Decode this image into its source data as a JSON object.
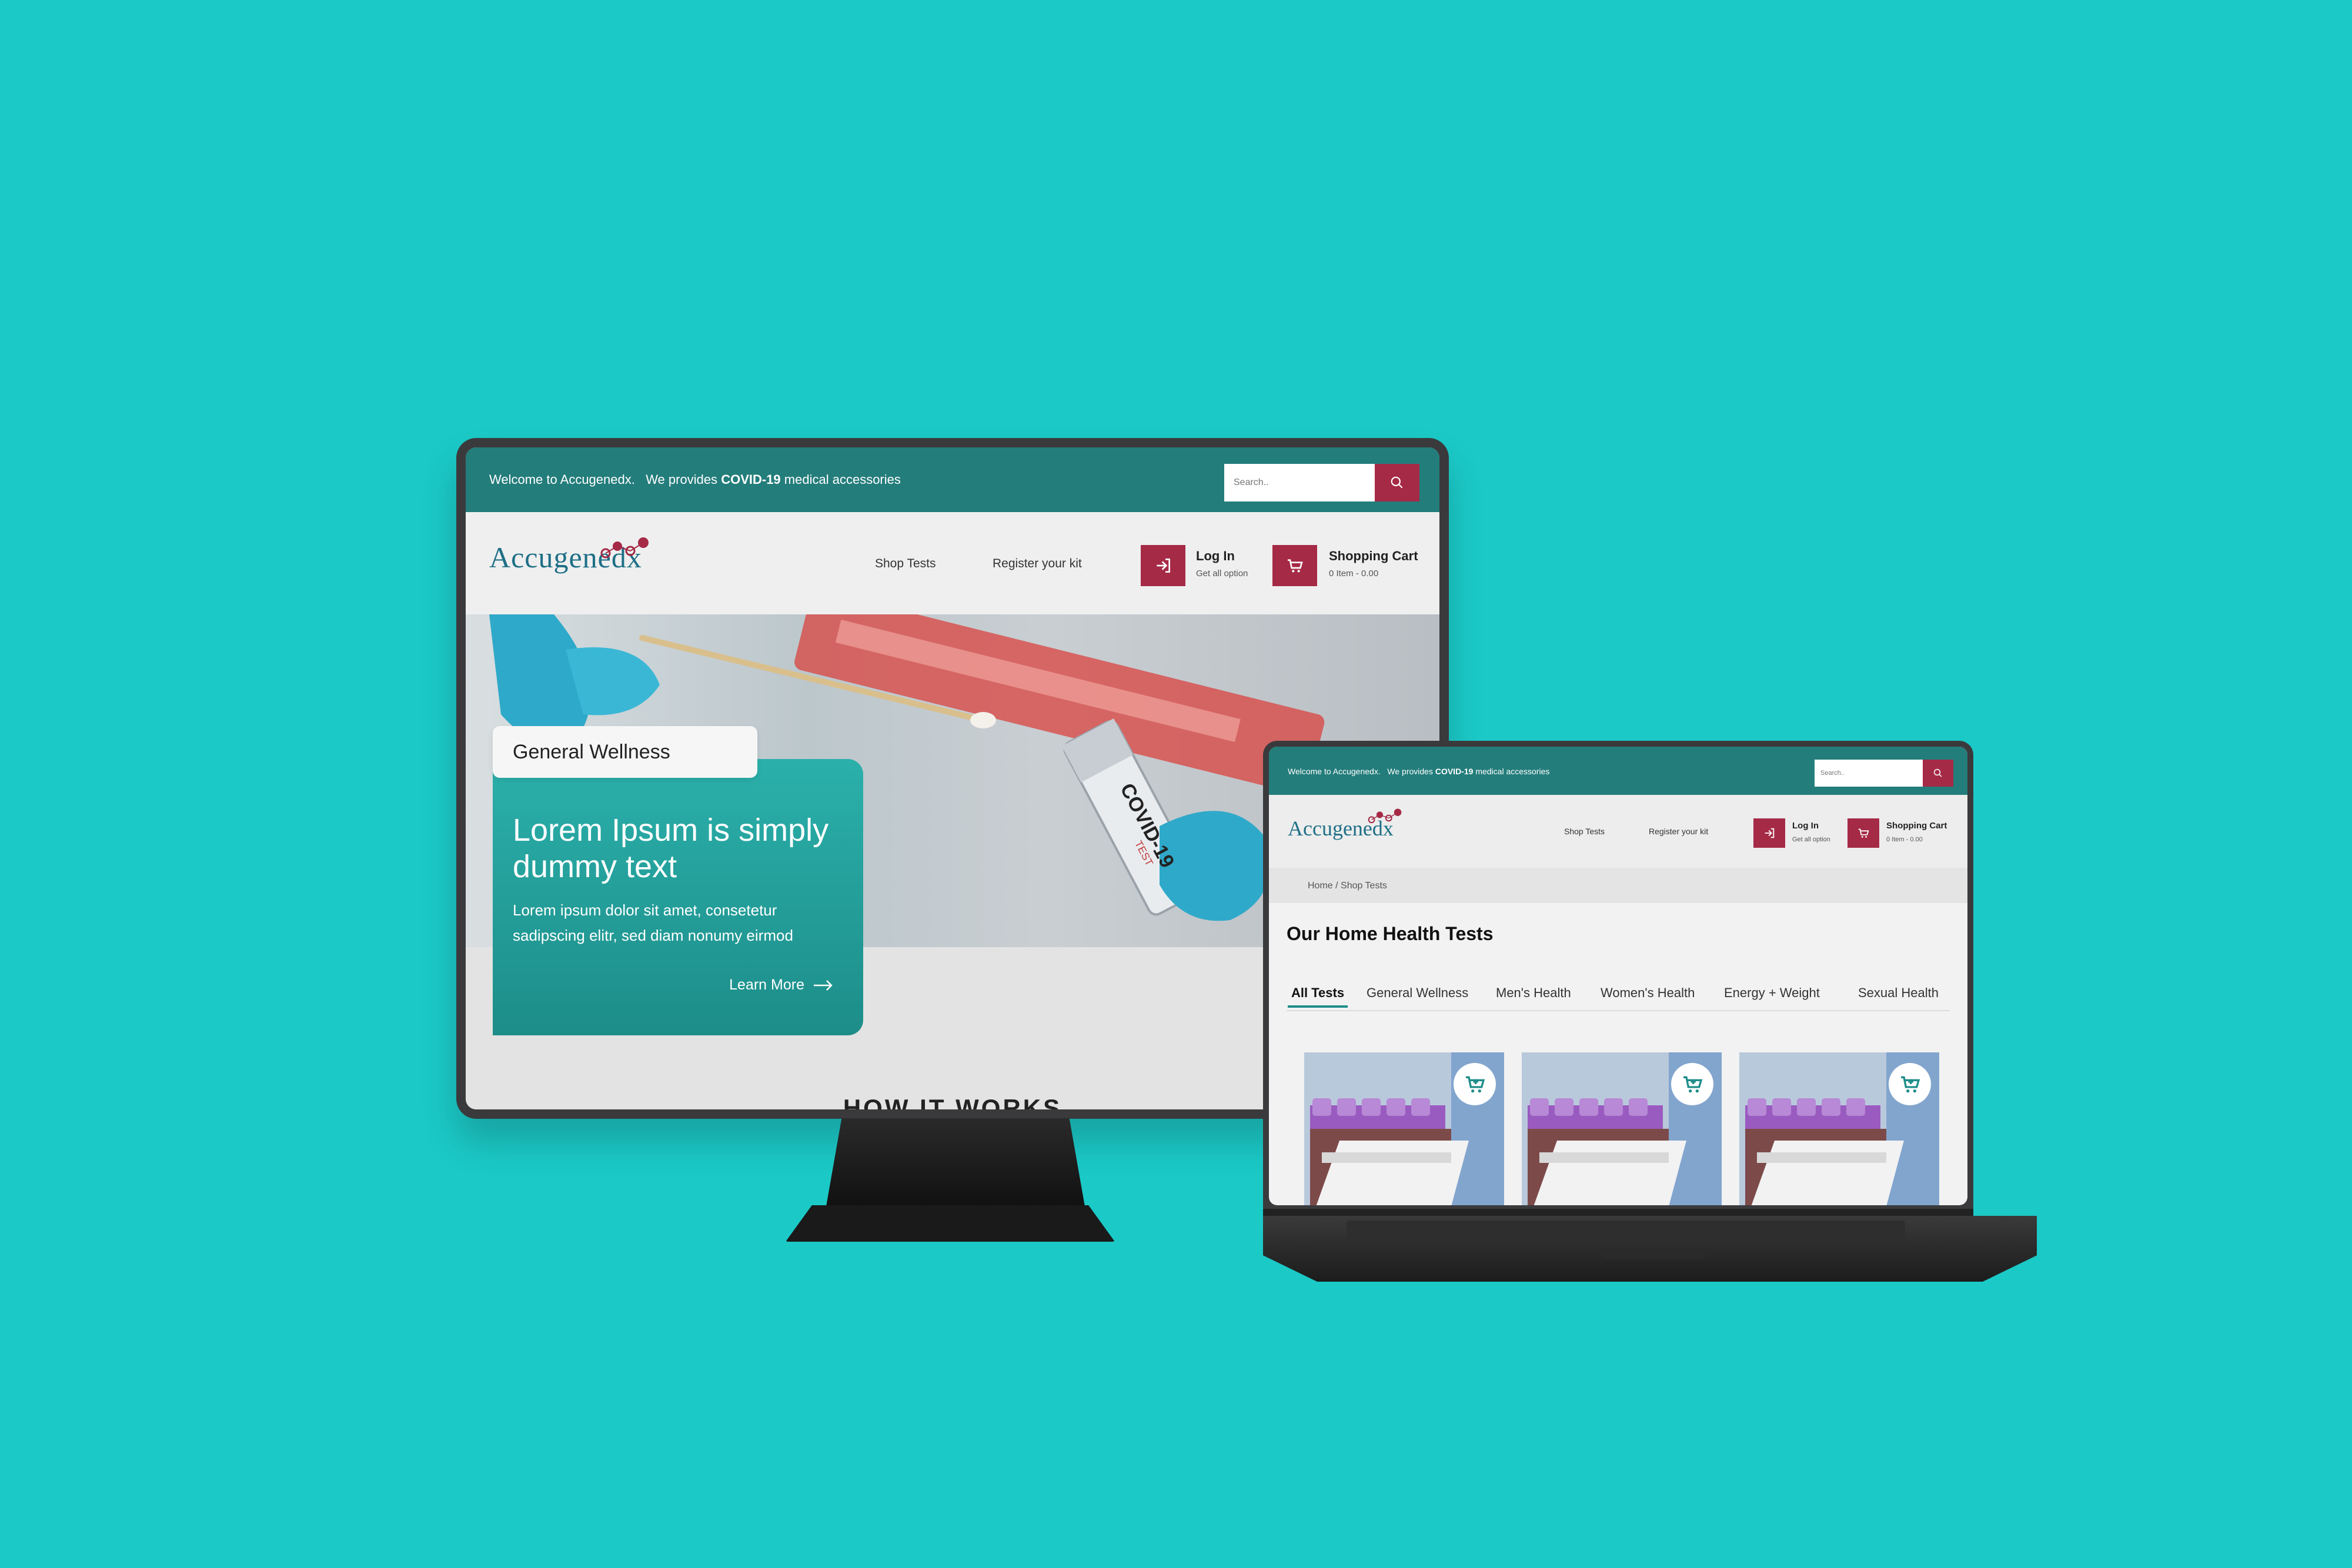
{
  "site": {
    "welcome_prefix": "Welcome to Accugenedx.",
    "welcome_mid": "We provides",
    "welcome_bold": "COVID-19",
    "welcome_suffix": "medical accessories",
    "search_placeholder": "Search..",
    "logo": "Accugenedx",
    "nav": {
      "shop_tests": "Shop Tests",
      "register_kit": "Register your kit"
    },
    "login": {
      "title": "Log In",
      "subtitle": "Get all option"
    },
    "cart": {
      "title": "Shopping Cart",
      "subtitle": "0 Item - 0.00"
    }
  },
  "monitor": {
    "hero_tag": "General Wellness",
    "hero_title": "Lorem Ipsum is simply dummy text",
    "hero_body": "Lorem ipsum dolor sit amet, consetetur sadipscing elitr, sed diam nonumy eirmod",
    "hero_cta": "Learn More",
    "vial_label": "COVID-19",
    "vial_sublabel": "TEST",
    "section_title": "HOW IT WORKS"
  },
  "laptop": {
    "breadcrumb": "Home / Shop Tests",
    "heading": "Our Home Health Tests",
    "tabs": [
      "All Tests",
      "General Wellness",
      "Men's Health",
      "Women's Health",
      "Energy + Weight",
      "Sexual Health"
    ],
    "active_tab": "All Tests"
  },
  "colors": {
    "background": "#1bc9c7",
    "topbar": "#237d7b",
    "accent": "#a52a46",
    "card": "#1d8d89",
    "logo": "#1e6f86"
  },
  "icons": [
    "search-icon",
    "login-icon",
    "cart-icon",
    "arrow-right-icon",
    "add-to-cart-icon"
  ]
}
